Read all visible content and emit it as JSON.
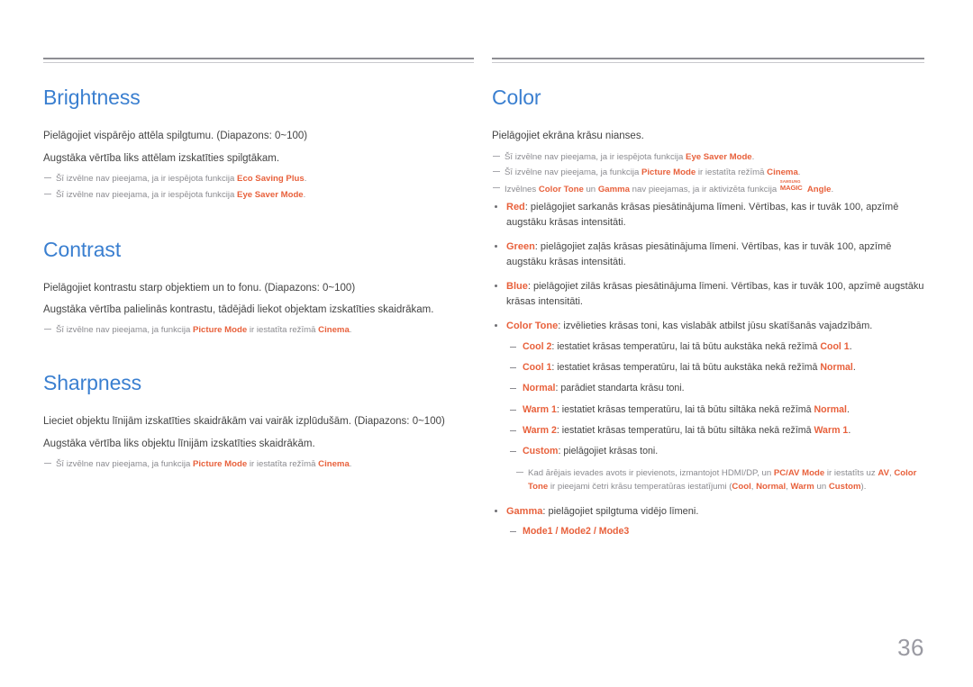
{
  "page": {
    "number": "36",
    "accent_blue": "#3a7fd0",
    "accent_orange": "#e8613c",
    "body_color": "#444444",
    "note_color": "#8b8b90"
  },
  "left_column": {
    "sections": [
      {
        "title": "Brightness",
        "body": [
          "Pielāgojiet vispārējo attēla spilgtumu. (Diapazons: 0~100)",
          "Augstāka vērtība liks attēlam izskatīties spilgtākam."
        ],
        "notes": [
          {
            "pre": "Šī izvēlne nav pieejama, ja ir iespējota funkcija ",
            "kw": "Eco Saving Plus",
            "post": "."
          },
          {
            "pre": "Šī izvēlne nav pieejama, ja ir iespējota funkcija ",
            "kw": "Eye Saver Mode",
            "post": "."
          }
        ]
      },
      {
        "title": "Contrast",
        "body": [
          "Pielāgojiet kontrastu starp objektiem un to fonu. (Diapazons: 0~100)",
          "Augstāka vērtība palielinās kontrastu, tādējādi liekot objektam izskatīties skaidrākam."
        ],
        "notes": [
          {
            "pre": "Šī izvēlne nav pieejama, ja funkcija ",
            "kw": "Picture Mode",
            "mid": " ir iestatīta režīmā ",
            "kw2": "Cinema",
            "post": "."
          }
        ]
      },
      {
        "title": "Sharpness",
        "body": [
          "Lieciet objektu līnijām izskatīties skaidrākām vai vairāk izplūdušām. (Diapazons: 0~100)",
          "Augstāka vērtība liks objektu līnijām izskatīties skaidrākām."
        ],
        "notes": [
          {
            "pre": "Šī izvēlne nav pieejama, ja funkcija ",
            "kw": "Picture Mode",
            "mid": " ir iestatīta režīmā ",
            "kw2": "Cinema",
            "post": "."
          }
        ]
      }
    ]
  },
  "right_column": {
    "title": "Color",
    "body": "Pielāgojiet ekrāna krāsu nianses.",
    "notes": [
      {
        "pre": "Šī izvēlne nav pieejama, ja ir iespējota funkcija ",
        "kw": "Eye Saver Mode",
        "post": "."
      },
      {
        "pre": "Šī izvēlne nav pieejama, ja funkcija ",
        "kw": "Picture Mode",
        "mid": " ir iestatīta režīmā ",
        "kw2": "Cinema",
        "post": "."
      },
      {
        "pre": "Izvēlnes ",
        "kw": "Color Tone",
        "mid": " un ",
        "kw2": "Gamma",
        "mid2": " nav pieejamas, ja ir aktivizēta funkcija ",
        "logo_samsung": "SAMSUNG",
        "logo_magic": "MAGIC",
        "kw3": "Angle",
        "post": "."
      }
    ],
    "bullets": [
      {
        "kw": "Red",
        "text": ": pielāgojiet sarkanās krāsas piesātinājuma līmeni. Vērtības, kas ir tuvāk 100, apzīmē augstāku krāsas intensitāti."
      },
      {
        "kw": "Green",
        "text": ": pielāgojiet zaļās krāsas piesātinājuma līmeni. Vērtības, kas ir tuvāk 100, apzīmē augstāku krāsas intensitāti."
      },
      {
        "kw": "Blue",
        "text": ": pielāgojiet zilās krāsas piesātinājuma līmeni. Vērtības, kas ir tuvāk 100, apzīmē augstāku krāsas intensitāti."
      }
    ],
    "color_tone": {
      "kw": "Color Tone",
      "text": ": izvēlieties krāsas toni, kas vislabāk atbilst jūsu skatīšanās vajadzībām.",
      "subs": [
        {
          "kw": "Cool 2",
          "mid": ": iestatiet krāsas temperatūru, lai tā būtu aukstāka nekā režīmā ",
          "kw2": "Cool 1",
          "post": "."
        },
        {
          "kw": "Cool 1",
          "mid": ": iestatiet krāsas temperatūru, lai tā būtu aukstāka nekā režīmā ",
          "kw2": "Normal",
          "post": "."
        },
        {
          "kw": "Normal",
          "mid": ": parādiet standarta krāsu toni.",
          "kw2": "",
          "post": ""
        },
        {
          "kw": "Warm 1",
          "mid": ": iestatiet krāsas temperatūru, lai tā būtu siltāka nekā režīmā ",
          "kw2": "Normal",
          "post": "."
        },
        {
          "kw": "Warm 2",
          "mid": ": iestatiet krāsas temperatūru, lai tā būtu siltāka nekā režīmā ",
          "kw2": "Warm 1",
          "post": "."
        },
        {
          "kw": "Custom",
          "mid": ": pielāgojiet krāsas toni.",
          "kw2": "",
          "post": ""
        }
      ]
    },
    "external_note": {
      "p1": "Kad ārējais ievades avots ir pievienots, izmantojot HDMI/DP, un ",
      "kw1": "PC/AV Mode",
      "p2": " ir iestatīts uz ",
      "kw2": "AV",
      "p3": ", ",
      "kw3": "Color Tone",
      "p4": " ir pieejami četri krāsu temperatūras iestatījumi (",
      "kw4": "Cool",
      "p5": ", ",
      "kw5": "Normal",
      "p6": ", ",
      "kw6": "Warm",
      "p7": " un ",
      "kw7": "Custom",
      "p8": ")."
    },
    "gamma": {
      "kw": "Gamma",
      "text": ": pielāgojiet spilgtuma vidējo līmeni.",
      "modes": "Mode1 / Mode2 / Mode3"
    }
  }
}
